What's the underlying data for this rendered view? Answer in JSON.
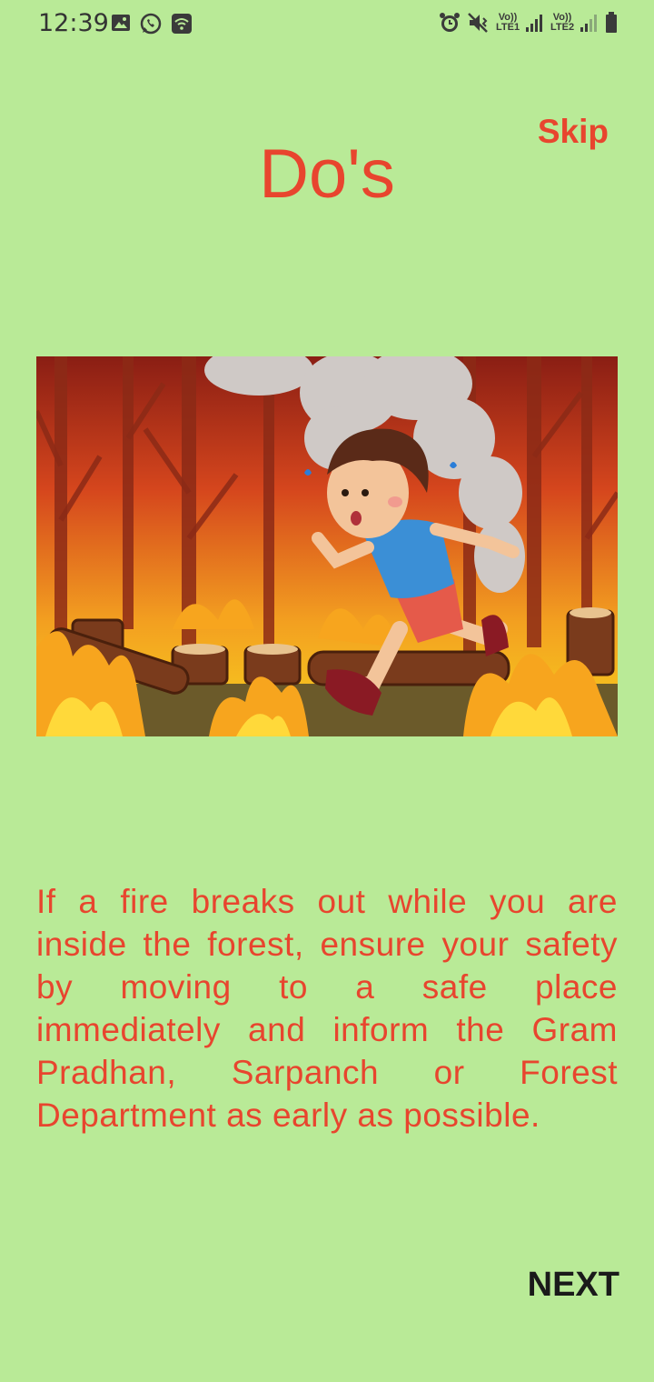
{
  "status_bar": {
    "time": "12:39",
    "left_icons": [
      "image-icon",
      "whatsapp-icon",
      "wifi-call-icon"
    ],
    "right_icons": [
      "alarm-icon",
      "mute-icon",
      "vibrate-icon",
      "volte-lte1-icon",
      "signal-icon",
      "volte-lte2-icon",
      "signal-icon",
      "battery-icon"
    ],
    "lte1_label": "Vo)) LTE1",
    "lte2_label": "Vo)) LTE2"
  },
  "header": {
    "skip_label": "Skip",
    "title": "Do's"
  },
  "illustration": {
    "description_icon": "boy-running-from-forest-fire-illustration"
  },
  "body": {
    "text": "If a fire breaks out while you are inside the forest, ensure your safety by moving to a safe place immediately and inform the Gram Pradhan, Sarpanch or Forest Department as early as possible."
  },
  "footer": {
    "next_label": "NEXT"
  },
  "colors": {
    "background": "#b9ea97",
    "accent": "#e8452e",
    "next_text": "#1a1a1a"
  }
}
